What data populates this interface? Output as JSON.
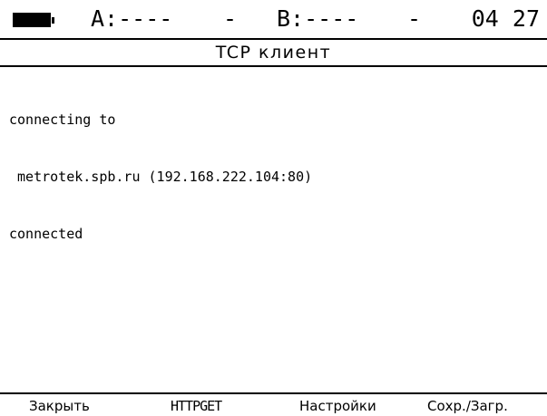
{
  "status": {
    "battery_icon": "battery-icon",
    "port_a": "A:----",
    "port_a_sep": "-",
    "port_b": "B:----",
    "port_b_sep": "-",
    "time": "04 27"
  },
  "title": "TCP клиент",
  "console": {
    "lines": [
      "connecting to",
      " metrotek.spb.ru (192.168.222.104:80)",
      "connected"
    ]
  },
  "softkeys": [
    {
      "label": "Закрыть"
    },
    {
      "label": "HTTPGET"
    },
    {
      "label": "Настройки"
    },
    {
      "label": "Сохр./Загр."
    }
  ],
  "colors": {
    "background": "#ffffff",
    "foreground": "#000000"
  }
}
